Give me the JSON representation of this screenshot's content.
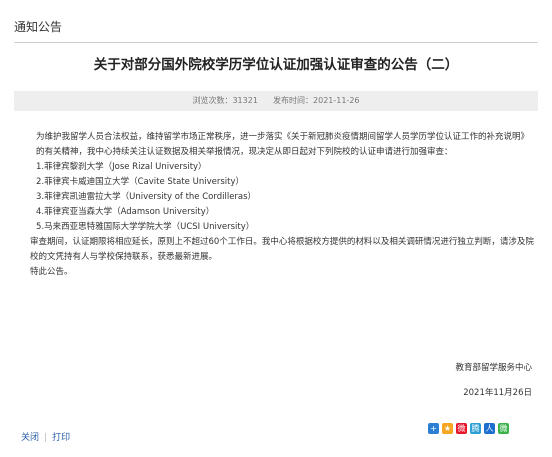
{
  "header": {
    "section": "通知公告"
  },
  "article": {
    "title": "关于对部分国外院校学历学位认证加强认证审查的公告（二）",
    "views_label": "浏览次数：",
    "views": "31321",
    "date_label": "发布时间：",
    "date": "2021-11-26",
    "intro": "为维护我留学人员合法权益，维持留学市场正常秩序，进一步落实《关于新冠肺炎疫情期间留学人员学历学位认证工作的补充说明》的有关精神，我中心持续关注认证数据及相关举报情况，现决定从即日起对下列院校的认证申请进行加强审查：",
    "items": [
      "1.菲律宾黎刹大学（Jose Rizal University）",
      "2.菲律宾卡威迪国立大学（Cavite State University）",
      "3.菲律宾凯迪雷拉大学（University of the Cordilleras）",
      "4.菲律宾亚当森大学（Adamson University）",
      "5.马来西亚思特雅国际大学学院大学（UCSI University）"
    ],
    "review": "审查期间，认证期限将相应延长，原则上不超过60个工作日。我中心将根据校方提供的材料以及相关调研情况进行独立判断，请涉及院校的文凭持有人与学校保持联系，获悉最新进展。",
    "closing": "特此公告。",
    "signature": "教育部留学服务中心",
    "sign_date": "2021年11月26日"
  },
  "footer": {
    "close_label": "关闭",
    "print_label": "打印",
    "share_icons": [
      {
        "name": "share-plus-icon",
        "color": "#2d7fd3",
        "glyph": "+"
      },
      {
        "name": "share-qzone-icon",
        "color": "#f5a623",
        "glyph": "★"
      },
      {
        "name": "share-weibo-icon",
        "color": "#e6162d",
        "glyph": "微"
      },
      {
        "name": "share-tqq-icon",
        "color": "#2d9fd3",
        "glyph": "腾"
      },
      {
        "name": "share-renren-icon",
        "color": "#1d6fcf",
        "glyph": "人"
      },
      {
        "name": "share-wechat-icon",
        "color": "#3bb34a",
        "glyph": "微"
      }
    ]
  }
}
